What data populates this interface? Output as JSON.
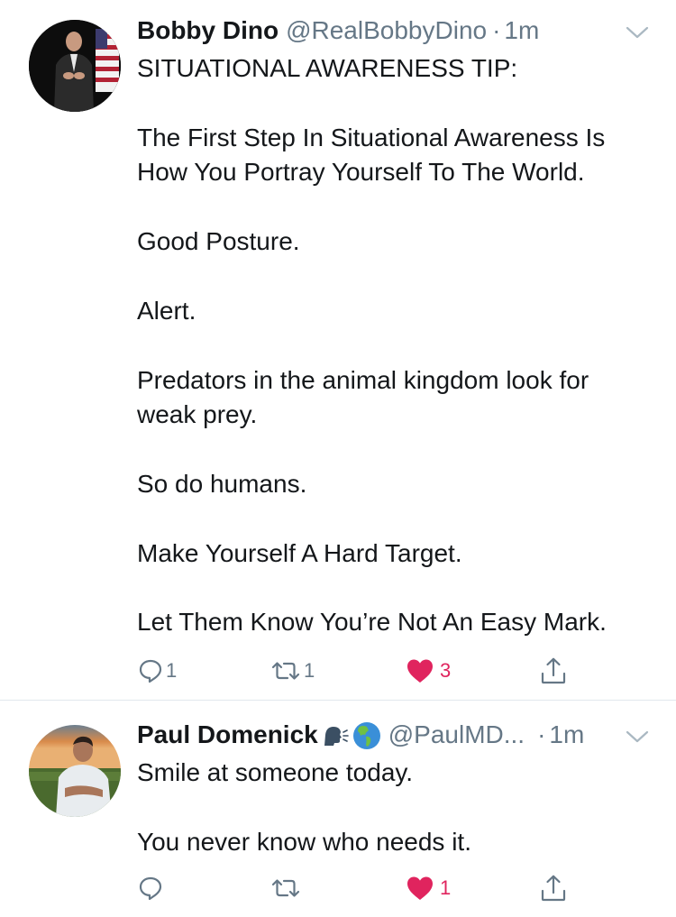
{
  "tweets": [
    {
      "name": "Bobby Dino",
      "handle": "@RealBobbyDino",
      "separator": "·",
      "time": "1m",
      "avatar_icon": "profile-photo-speaker-with-flag",
      "text_lines": [
        "SITUATIONAL AWARENESS TIP:",
        "",
        "The First Step In Situational Awareness Is",
        "How You Portray Yourself To The World.",
        "",
        "Good Posture.",
        "",
        "Alert.",
        "",
        "Predators in the animal kingdom look for",
        "weak prey.",
        "",
        "So do humans.",
        "",
        "Make Yourself A Hard Target.",
        "",
        "Let Them Know You’re Not An Easy Mark."
      ],
      "actions": {
        "replies": "1",
        "retweets": "1",
        "likes": "3"
      },
      "liked": true
    },
    {
      "name": "Paul Domenick",
      "handle": "@PaulMD...",
      "separator": "·",
      "time": "1m",
      "avatar_icon": "profile-photo-man-outdoors",
      "name_emojis": [
        "speaking-head-emoji",
        "globe-americas-emoji"
      ],
      "text_lines": [
        "Smile at someone today.",
        "",
        "You never know who needs it."
      ],
      "actions": {
        "replies": "",
        "retweets": "",
        "likes": "1"
      },
      "liked": true
    }
  ],
  "colors": {
    "text": "#14171a",
    "secondary": "#657786",
    "like": "#e0245e",
    "divider": "#e1e8ed"
  },
  "icons": {
    "reply": "reply-icon",
    "retweet": "retweet-icon",
    "like": "heart-icon",
    "share": "share-icon",
    "menu": "chevron-down-icon"
  }
}
